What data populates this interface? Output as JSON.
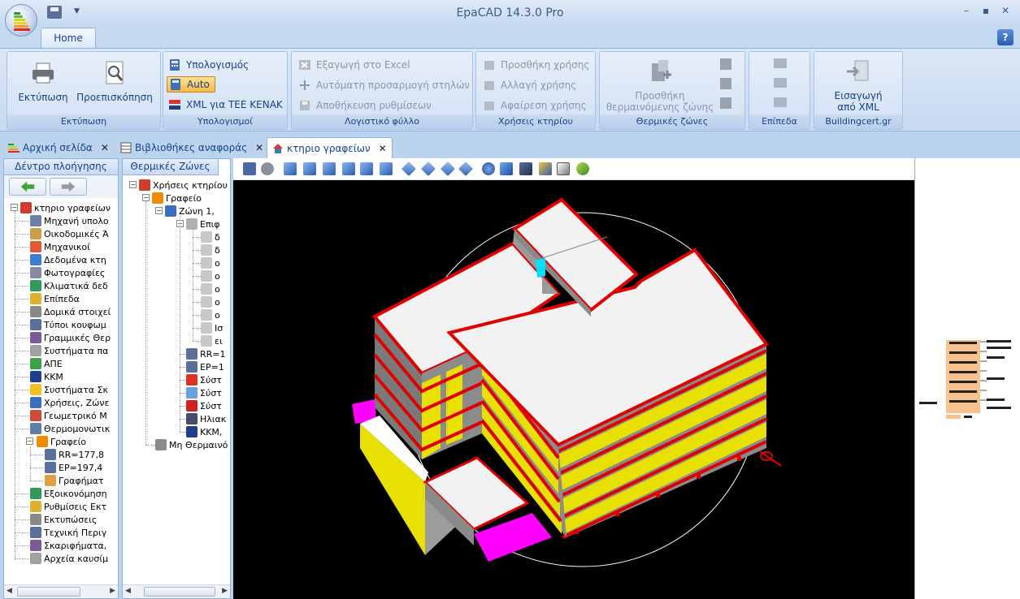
{
  "window": {
    "title": "EpaCAD 14.3.0 Pro"
  },
  "ribbon": {
    "tab": "Home",
    "groups": {
      "print": {
        "label": "Εκτύπωση",
        "print_btn": "Εκτύπωση",
        "preview_btn": "Προεπισκόπηση"
      },
      "calc": {
        "label": "Υπολογισμοί",
        "calc_btn": "Υπολογισμός",
        "auto_btn": "Auto",
        "xml_btn": "XML για ΤΕΕ ΚΕΝΑΚ"
      },
      "sheet": {
        "label": "Λογιστικό φύλλο",
        "export_btn": "Εξαγωγή στο Excel",
        "autofit_btn": "Αυτόματη προσαρμογή στηλών",
        "save_btn": "Αποθήκευση ρυθμίσεων"
      },
      "uses": {
        "label": "Χρήσεις κτηρίου",
        "add_btn": "Προσθήκη χρήσης",
        "change_btn": "Αλλαγή χρήσης",
        "remove_btn": "Αφαίρεση χρήσης"
      },
      "zones": {
        "label": "Θερμικές ζώνες",
        "add_line1": "Προσθήκη",
        "add_line2": "θερμαινόμενης ζώνης"
      },
      "levels": {
        "label": "Επίπεδα"
      },
      "bcert": {
        "label": "Buildingcert.gr",
        "import_line1": "Εισαγωγή",
        "import_line2": "από XML"
      }
    }
  },
  "doctabs": [
    {
      "label": "Αρχική σελίδα"
    },
    {
      "label": "Βιβλιοθήκες αναφοράς"
    },
    {
      "label": "κτηριο γραφείων"
    }
  ],
  "left_panel": {
    "title": "Δέντρο πλοήγησης",
    "root": "κτηριο γραφείων",
    "items": [
      "Μηχανή υπολο",
      "Οικοδομικές Ά",
      "Μηχανικοί",
      "Δεδομένα κτη",
      "Φωτογραφίες",
      "Κλιματικά δεδ",
      "Επίπεδα",
      "Δομικά στοιχεί",
      "Τύποι κουφωμ",
      "Γραμμικές Θερ",
      "Συστήματα πα",
      "ΑΠΕ",
      "ΚΚΜ",
      "Συστήματα Σκ",
      "Χρήσεις, Ζώνε",
      "Γεωμετρικό Μ",
      "Θερμομονωτικ"
    ],
    "grafeio": "Γραφείο",
    "grafeio_children": [
      "RR=177,8",
      "EP=197,4",
      "Γραφήματ"
    ],
    "items_after": [
      "Εξοικονόμηση",
      "Ρυθμίσεις Εκτ",
      "Εκτυπώσεις",
      "Τεχνική Περιγ",
      "Σκαριφήματα,",
      "Αρχεία καυσίμ"
    ]
  },
  "zones_panel": {
    "title": "Θερμικές Ζώνες",
    "root": "Χρήσεις κτηρίου",
    "use": "Γραφείο",
    "zone": "Ζώνη 1,",
    "surfaces_root": "Επιφ",
    "surfaces": [
      "δ",
      "δ",
      "ο",
      "ο",
      "ο",
      "ο",
      "ο",
      "Ισ",
      "ει"
    ],
    "results": [
      "RR=1",
      "EP=1"
    ],
    "systems": [
      "Σύστ",
      "Σύστ",
      "Σύστ",
      "Ηλιακ",
      "ΚΚΜ,"
    ],
    "unheated": "Μη Θερμαινό"
  },
  "colors": {
    "ribbon_bg": "#dbe7f6",
    "accent": "#15428b",
    "roof": "#f2f2f2",
    "slab_edge": "#e00000",
    "wall": "#8a8a8a",
    "glazing": "#e8e000",
    "ground": "#ff00ff",
    "viewport_bg": "#000000"
  }
}
